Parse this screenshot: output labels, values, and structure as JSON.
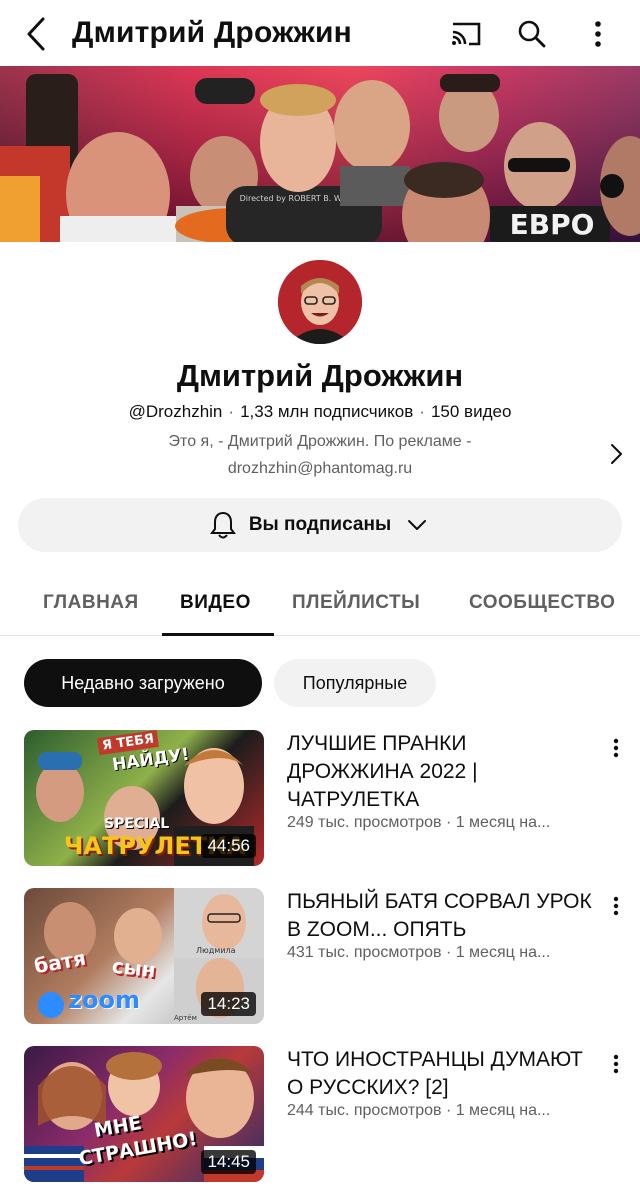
{
  "header": {
    "title": "Дмитрий Дрожжин",
    "icons": [
      "back-icon",
      "cast-icon",
      "search-icon",
      "more-vert-icon"
    ]
  },
  "banner": {
    "shirt_text": "Directed by ROBERT B. WEIDE",
    "logo_text": "ЕВРО"
  },
  "channel": {
    "name": "Дмитрий Дрожжин",
    "handle": "@Drozhzhin",
    "subscribers": "1,33 млн подписчиков",
    "video_count": "150 видео",
    "description_line1": "Это я, - Дмитрий Дрожжин. По рекламе -",
    "description_line2": "drozhzhin@phantomag.ru",
    "subscribe_label": "Вы подписаны"
  },
  "tabs": [
    {
      "label": "ГЛАВНАЯ",
      "active": false
    },
    {
      "label": "ВИДЕО",
      "active": true
    },
    {
      "label": "ПЛЕЙЛИСТЫ",
      "active": false
    },
    {
      "label": "СООБЩЕСТВО",
      "active": false
    }
  ],
  "chips": [
    {
      "label": "Недавно загружено",
      "selected": true
    },
    {
      "label": "Популярные",
      "selected": false
    }
  ],
  "videos": [
    {
      "title": "ЛУЧШИЕ ПРАНКИ ДРОЖЖИНА 2022 | ЧАТРУЛЕТКА",
      "meta": "249 тыс. просмотров · 1 месяц на...",
      "duration": "44:56",
      "thumb_text": [
        "Я ТЕБЯ",
        "НАЙДУ!",
        "SPECIAL",
        "ЧАТРУЛЕТКА"
      ]
    },
    {
      "title": "ПЬЯНЫЙ БАТЯ СОРВАЛ УРОК В ZOOM... ОПЯТЬ",
      "meta": "431 тыс. просмотров · 1 месяц на...",
      "duration": "14:23",
      "thumb_text": [
        "батя",
        "сын",
        "zoom",
        "Людмила",
        "Артём"
      ]
    },
    {
      "title": "ЧТО ИНОСТРАНЦЫ ДУМАЮТ О РУССКИХ? [2]",
      "meta": "244 тыс. просмотров · 1 месяц на...",
      "duration": "14:45",
      "thumb_text": [
        "МНЕ",
        "СТРАШНО!"
      ]
    }
  ],
  "colors": {
    "text_primary": "#0f0f0f",
    "text_secondary": "#606060",
    "chip_selected_bg": "#0f0f0f",
    "chip_bg": "#f2f2f2"
  }
}
